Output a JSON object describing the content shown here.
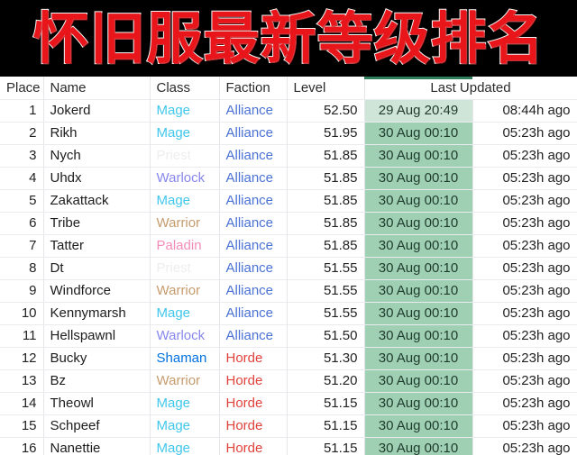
{
  "banner": {
    "title": "怀旧服最新等级排名",
    "title_color": "#e8161a",
    "outline_color": "#ffffff",
    "background_color": "#000000"
  },
  "table": {
    "highlight_color": "#9fd0b4",
    "highlight_first_row_color": "#cfe5d8",
    "highlight_strip_color": "#2e7d5b",
    "headers": {
      "place": "Place",
      "name": "Name",
      "class": "Class",
      "faction": "Faction",
      "level": "Level",
      "last_updated": "Last Updated",
      "ago": ""
    },
    "class_colors": {
      "Mage": "#40c7eb",
      "Priest": "#eeeeee",
      "Warlock": "#8787ed",
      "Warrior": "#c69b6d",
      "Paladin": "#f48cba",
      "Shaman": "#0070de"
    },
    "faction_colors": {
      "Alliance": "#4a72d4",
      "Horde": "#e0433c"
    },
    "rows": [
      {
        "place": "1",
        "name": "Jokerd",
        "class": "Mage",
        "faction": "Alliance",
        "level": "52.50",
        "updated": "29 Aug 20:49",
        "ago": "08:44h ago"
      },
      {
        "place": "2",
        "name": "Rikh",
        "class": "Mage",
        "faction": "Alliance",
        "level": "51.95",
        "updated": "30 Aug 00:10",
        "ago": "05:23h ago"
      },
      {
        "place": "3",
        "name": "Nych",
        "class": "Priest",
        "faction": "Alliance",
        "level": "51.85",
        "updated": "30 Aug 00:10",
        "ago": "05:23h ago"
      },
      {
        "place": "4",
        "name": "Uhdx",
        "class": "Warlock",
        "faction": "Alliance",
        "level": "51.85",
        "updated": "30 Aug 00:10",
        "ago": "05:23h ago"
      },
      {
        "place": "5",
        "name": "Zakattack",
        "class": "Mage",
        "faction": "Alliance",
        "level": "51.85",
        "updated": "30 Aug 00:10",
        "ago": "05:23h ago"
      },
      {
        "place": "6",
        "name": "Tribe",
        "class": "Warrior",
        "faction": "Alliance",
        "level": "51.85",
        "updated": "30 Aug 00:10",
        "ago": "05:23h ago"
      },
      {
        "place": "7",
        "name": "Tatter",
        "class": "Paladin",
        "faction": "Alliance",
        "level": "51.85",
        "updated": "30 Aug 00:10",
        "ago": "05:23h ago"
      },
      {
        "place": "8",
        "name": "Dt",
        "class": "Priest",
        "faction": "Alliance",
        "level": "51.55",
        "updated": "30 Aug 00:10",
        "ago": "05:23h ago"
      },
      {
        "place": "9",
        "name": "Windforce",
        "class": "Warrior",
        "faction": "Alliance",
        "level": "51.55",
        "updated": "30 Aug 00:10",
        "ago": "05:23h ago"
      },
      {
        "place": "10",
        "name": "Kennymarsh",
        "class": "Mage",
        "faction": "Alliance",
        "level": "51.55",
        "updated": "30 Aug 00:10",
        "ago": "05:23h ago"
      },
      {
        "place": "11",
        "name": "Hellspawnl",
        "class": "Warlock",
        "faction": "Alliance",
        "level": "51.50",
        "updated": "30 Aug 00:10",
        "ago": "05:23h ago"
      },
      {
        "place": "12",
        "name": "Bucky",
        "class": "Shaman",
        "faction": "Horde",
        "level": "51.30",
        "updated": "30 Aug 00:10",
        "ago": "05:23h ago"
      },
      {
        "place": "13",
        "name": "Bz",
        "class": "Warrior",
        "faction": "Horde",
        "level": "51.20",
        "updated": "30 Aug 00:10",
        "ago": "05:23h ago"
      },
      {
        "place": "14",
        "name": "Theowl",
        "class": "Mage",
        "faction": "Horde",
        "level": "51.15",
        "updated": "30 Aug 00:10",
        "ago": "05:23h ago"
      },
      {
        "place": "15",
        "name": "Schpeef",
        "class": "Mage",
        "faction": "Horde",
        "level": "51.15",
        "updated": "30 Aug 00:10",
        "ago": "05:23h ago"
      },
      {
        "place": "16",
        "name": "Nanettie",
        "class": "Mage",
        "faction": "Horde",
        "level": "51.15",
        "updated": "30 Aug 00:10",
        "ago": "05:23h ago"
      }
    ]
  }
}
